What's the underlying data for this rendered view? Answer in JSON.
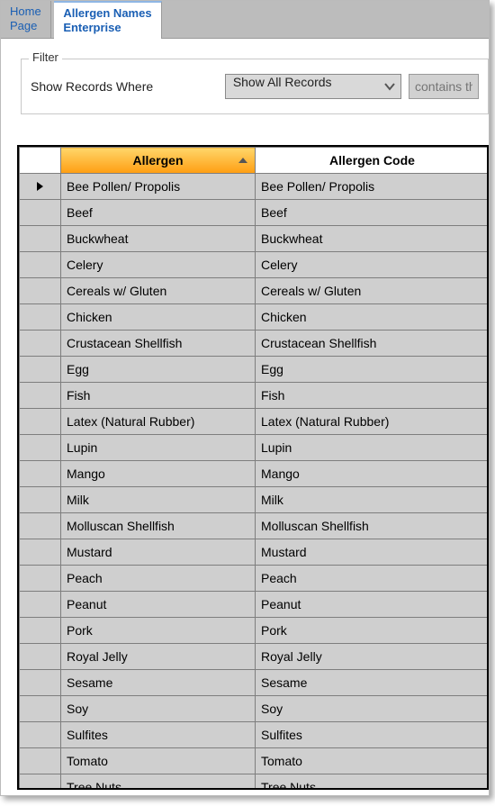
{
  "tabs": [
    {
      "line1": "Home",
      "line2": "Page",
      "active": false
    },
    {
      "line1": "Allergen Names",
      "line2": "Enterprise",
      "active": true
    }
  ],
  "filter": {
    "legend": "Filter",
    "label": "Show Records Where",
    "selected": "Show All Records",
    "textPlaceholder": "contains the te"
  },
  "grid": {
    "columns": [
      {
        "header": "Allergen",
        "sorted": true
      },
      {
        "header": "Allergen Code",
        "sorted": false
      }
    ],
    "rows": [
      {
        "current": true,
        "allergen": "Bee Pollen/ Propolis",
        "code": "Bee Pollen/ Propolis"
      },
      {
        "current": false,
        "allergen": "Beef",
        "code": "Beef"
      },
      {
        "current": false,
        "allergen": "Buckwheat",
        "code": "Buckwheat"
      },
      {
        "current": false,
        "allergen": "Celery",
        "code": "Celery"
      },
      {
        "current": false,
        "allergen": "Cereals w/ Gluten",
        "code": "Cereals w/ Gluten"
      },
      {
        "current": false,
        "allergen": "Chicken",
        "code": "Chicken"
      },
      {
        "current": false,
        "allergen": "Crustacean Shellfish",
        "code": "Crustacean Shellfish"
      },
      {
        "current": false,
        "allergen": "Egg",
        "code": "Egg"
      },
      {
        "current": false,
        "allergen": "Fish",
        "code": "Fish"
      },
      {
        "current": false,
        "allergen": "Latex (Natural Rubber)",
        "code": "Latex (Natural Rubber)"
      },
      {
        "current": false,
        "allergen": "Lupin",
        "code": "Lupin"
      },
      {
        "current": false,
        "allergen": "Mango",
        "code": "Mango"
      },
      {
        "current": false,
        "allergen": "Milk",
        "code": "Milk"
      },
      {
        "current": false,
        "allergen": "Molluscan Shellfish",
        "code": "Molluscan Shellfish"
      },
      {
        "current": false,
        "allergen": "Mustard",
        "code": "Mustard"
      },
      {
        "current": false,
        "allergen": "Peach",
        "code": "Peach"
      },
      {
        "current": false,
        "allergen": "Peanut",
        "code": "Peanut"
      },
      {
        "current": false,
        "allergen": "Pork",
        "code": "Pork"
      },
      {
        "current": false,
        "allergen": "Royal Jelly",
        "code": "Royal Jelly"
      },
      {
        "current": false,
        "allergen": "Sesame",
        "code": "Sesame"
      },
      {
        "current": false,
        "allergen": "Soy",
        "code": "Soy"
      },
      {
        "current": false,
        "allergen": "Sulfites",
        "code": "Sulfites"
      },
      {
        "current": false,
        "allergen": "Tomato",
        "code": "Tomato"
      },
      {
        "current": false,
        "allergen": "Tree Nuts",
        "code": "Tree Nuts"
      }
    ]
  }
}
